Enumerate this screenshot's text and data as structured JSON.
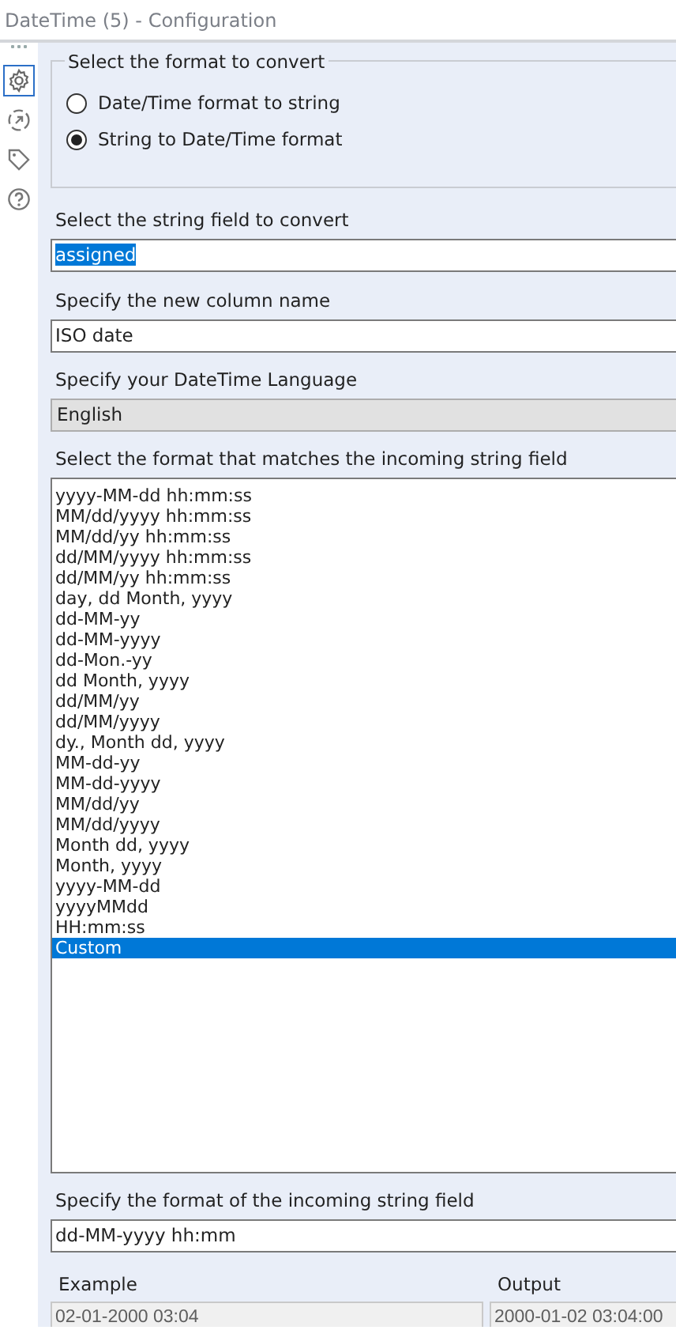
{
  "window": {
    "title": "DateTime (5) - Configuration"
  },
  "sidebar": {
    "items": [
      {
        "kind": "gear",
        "selected": true
      },
      {
        "kind": "arrow",
        "selected": false
      },
      {
        "kind": "tag",
        "selected": false
      },
      {
        "kind": "help",
        "selected": false
      }
    ]
  },
  "convert_group": {
    "title": "Select the format to convert",
    "options": [
      {
        "label": "Date/Time format to string",
        "selected": false
      },
      {
        "label": "String to Date/Time format",
        "selected": true
      }
    ]
  },
  "string_field": {
    "label": "Select the string field to convert",
    "value": "assigned",
    "highlighted": true
  },
  "column_name": {
    "label": "Specify the new column name",
    "value": "ISO date"
  },
  "language": {
    "label": "Specify your DateTime Language",
    "value": "English"
  },
  "formats": {
    "label": "Select the format that matches the incoming string field",
    "items": [
      {
        "label": "yyyy-MM-dd hh:mm:ss",
        "selected": false
      },
      {
        "label": "MM/dd/yyyy hh:mm:ss",
        "selected": false
      },
      {
        "label": "MM/dd/yy hh:mm:ss",
        "selected": false
      },
      {
        "label": "dd/MM/yyyy hh:mm:ss",
        "selected": false
      },
      {
        "label": "dd/MM/yy hh:mm:ss",
        "selected": false
      },
      {
        "label": "day, dd Month, yyyy",
        "selected": false
      },
      {
        "label": "dd-MM-yy",
        "selected": false
      },
      {
        "label": "dd-MM-yyyy",
        "selected": false
      },
      {
        "label": "dd-Mon.-yy",
        "selected": false
      },
      {
        "label": "dd Month, yyyy",
        "selected": false
      },
      {
        "label": "dd/MM/yy",
        "selected": false
      },
      {
        "label": "dd/MM/yyyy",
        "selected": false
      },
      {
        "label": "dy., Month dd, yyyy",
        "selected": false
      },
      {
        "label": "MM-dd-yy",
        "selected": false
      },
      {
        "label": "MM-dd-yyyy",
        "selected": false
      },
      {
        "label": "MM/dd/yy",
        "selected": false
      },
      {
        "label": "MM/dd/yyyy",
        "selected": false
      },
      {
        "label": "Month dd, yyyy",
        "selected": false
      },
      {
        "label": "Month, yyyy",
        "selected": false
      },
      {
        "label": "yyyy-MM-dd",
        "selected": false
      },
      {
        "label": "yyyyMMdd",
        "selected": false
      },
      {
        "label": "HH:mm:ss",
        "selected": false
      },
      {
        "label": "Custom",
        "selected": true
      }
    ]
  },
  "custom_format": {
    "label": "Specify the format of the incoming string field",
    "value": "dd-MM-yyyy hh:mm"
  },
  "example": {
    "label": "Example",
    "value": "02-01-2000 03:04"
  },
  "output": {
    "label": "Output",
    "value": "2000-01-02 03:04:00"
  }
}
